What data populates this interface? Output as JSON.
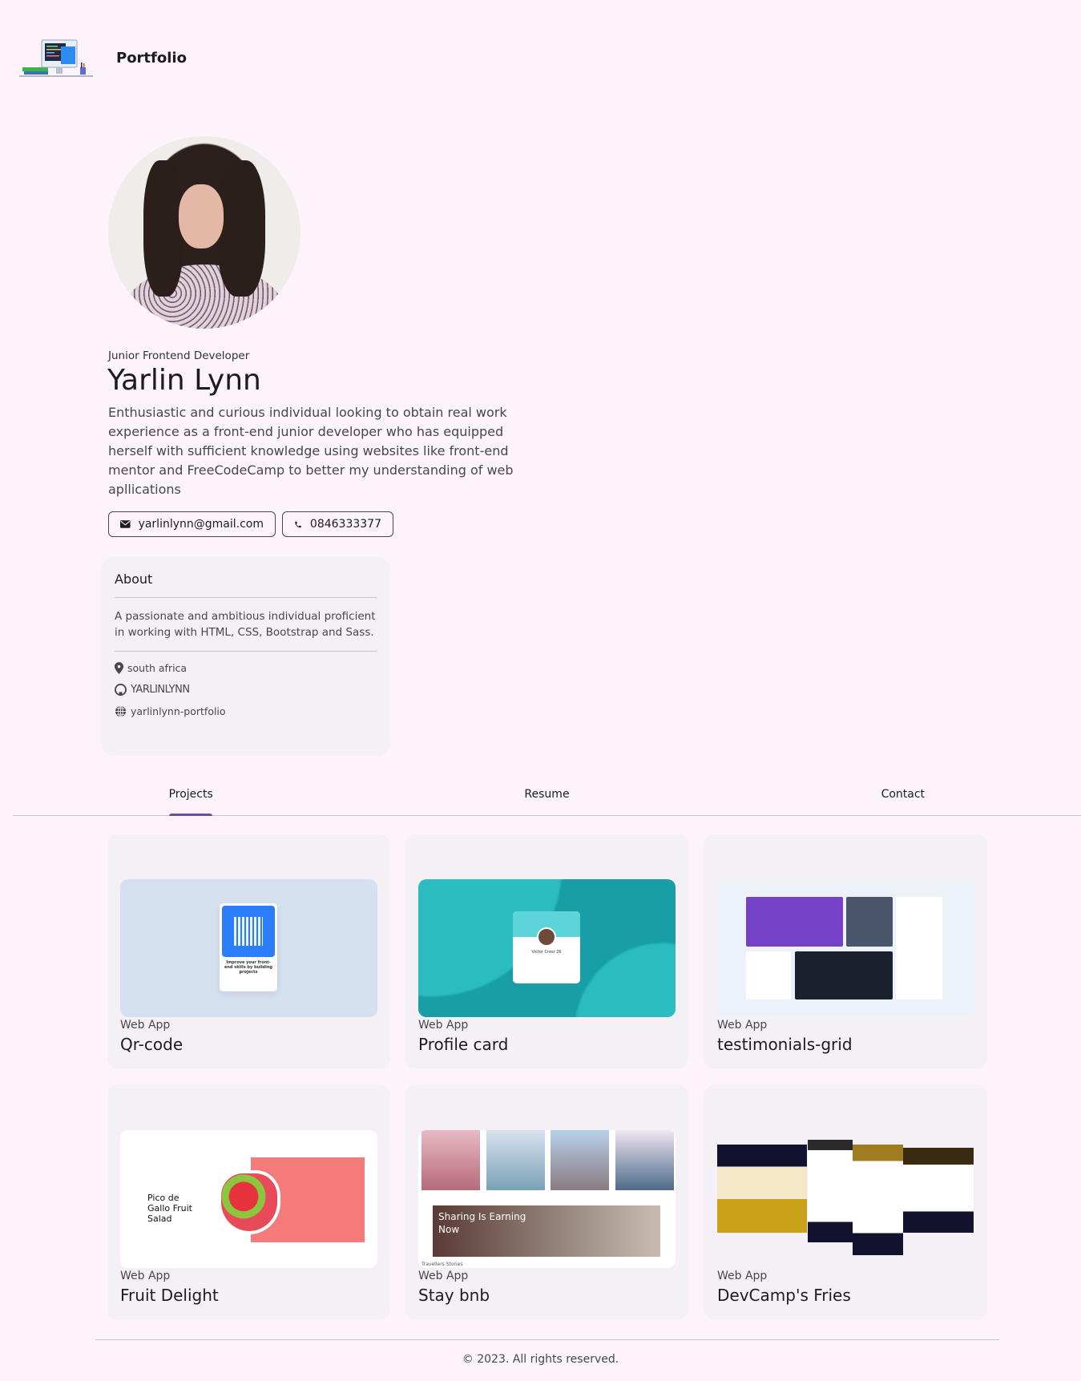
{
  "header": {
    "brand": "Portfolio",
    "logo_icon": "computer-desk-illustration"
  },
  "profile": {
    "role": "Junior Frontend Developer",
    "name": "Yarlin Lynn",
    "bio": "Enthusiastic and curious individual looking to obtain real work experience as a front-end junior developer who has equipped herself with sufficient knowledge using websites like front-end mentor and FreeCodeCamp to better my understanding of web apllications",
    "email": "yarlinlynn@gmail.com",
    "phone": "0846333377"
  },
  "about": {
    "title": "About",
    "text": "A passionate and ambitious individual proficient in working with HTML, CSS, Bootstrap and Sass.",
    "location": "south africa",
    "github": "YARLINLYNN",
    "website": "yarlinlynn-portfolio"
  },
  "tabs": [
    {
      "label": "Projects",
      "active": true
    },
    {
      "label": "Resume"
    },
    {
      "label": "Contact"
    }
  ],
  "accent": "#6750a4",
  "projects": [
    {
      "type": "Web App",
      "title": "Qr-code",
      "thumb_text": "Improve your front-end skills by building projects"
    },
    {
      "type": "Web App",
      "title": "Profile card",
      "thumb_text": "Victor Crest 26"
    },
    {
      "type": "Web App",
      "title": "testimonials-grid"
    },
    {
      "type": "Web App",
      "title": "Fruit Delight",
      "thumb_text": "Pico de Gallo Fruit Salad"
    },
    {
      "type": "Web App",
      "title": "Stay bnb",
      "thumb_text": "Sharing Is Earning Now",
      "thumb_caption": "Travellers Stories"
    },
    {
      "type": "Web App",
      "title": "DevCamp's Fries"
    }
  ],
  "footer": {
    "text": "© 2023. All rights reserved."
  }
}
